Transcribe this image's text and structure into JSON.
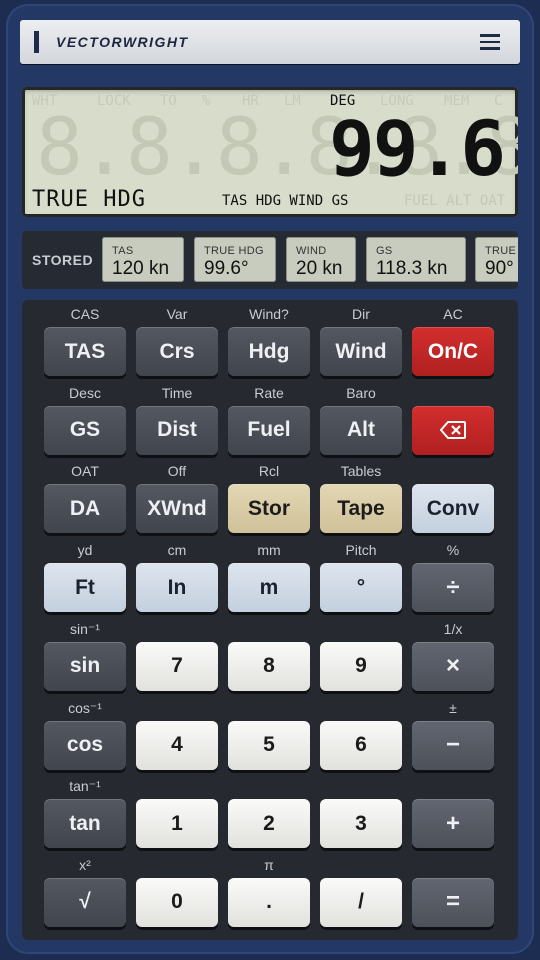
{
  "header": {
    "brand": "VECTORWRIGHT",
    "menu_icon": "hamburger-menu-icon"
  },
  "display": {
    "annunciators": [
      {
        "label": "WHT",
        "on": false
      },
      {
        "label": "LOCK",
        "on": false
      },
      {
        "label": "TO",
        "on": false
      },
      {
        "label": "%",
        "on": false
      },
      {
        "label": "HR",
        "on": false
      },
      {
        "label": "LM",
        "on": false
      },
      {
        "label": "DEG",
        "on": true
      },
      {
        "label": "LONG",
        "on": false
      },
      {
        "label": "MEM",
        "on": false
      },
      {
        "label": "C",
        "on": false
      }
    ],
    "ghost_digits": "8.8.8.8.8.8.8.8.8",
    "value": "99.6",
    "label": "TRUE HDG",
    "key_row": "TAS HDG WIND GS",
    "key_row_ghost": "FUEL ALT OAT"
  },
  "stored": {
    "label": "STORED",
    "items": [
      {
        "title": "TAS",
        "value": "120 kn"
      },
      {
        "title": "TRUE HDG",
        "value": "99.6°"
      },
      {
        "title": "WIND",
        "value": "20 kn"
      },
      {
        "title": "GS",
        "value": "118.3 kn"
      },
      {
        "title": "TRUE",
        "value": "90°"
      }
    ]
  },
  "keypad": {
    "rows": [
      [
        {
          "sub": "CAS",
          "label": "TAS",
          "style": "dark"
        },
        {
          "sub": "Var",
          "label": "Crs",
          "style": "dark"
        },
        {
          "sub": "Wind?",
          "label": "Hdg",
          "style": "dark"
        },
        {
          "sub": "Dir",
          "label": "Wind",
          "style": "dark"
        },
        {
          "sub": "AC",
          "label": "On/C",
          "style": "red"
        }
      ],
      [
        {
          "sub": "Desc",
          "label": "GS",
          "style": "dark"
        },
        {
          "sub": "Time",
          "label": "Dist",
          "style": "dark"
        },
        {
          "sub": "Rate",
          "label": "Fuel",
          "style": "dark"
        },
        {
          "sub": "Baro",
          "label": "Alt",
          "style": "dark"
        },
        {
          "sub": "",
          "label": "",
          "style": "red",
          "icon": "backspace-icon"
        }
      ],
      [
        {
          "sub": "OAT",
          "label": "DA",
          "style": "dark"
        },
        {
          "sub": "Off",
          "label": "XWnd",
          "style": "dark"
        },
        {
          "sub": "Rcl",
          "label": "Stor",
          "style": "tan"
        },
        {
          "sub": "Tables",
          "label": "Tape",
          "style": "tan"
        },
        {
          "sub": "",
          "label": "Conv",
          "style": "blue"
        }
      ],
      [
        {
          "sub": "yd",
          "label": "Ft",
          "style": "blue"
        },
        {
          "sub": "cm",
          "label": "In",
          "style": "blue"
        },
        {
          "sub": "mm",
          "label": "m",
          "style": "blue"
        },
        {
          "sub": "Pitch",
          "label": "°",
          "style": "blue"
        },
        {
          "sub": "%",
          "label": "÷",
          "style": "gray"
        }
      ],
      [
        {
          "sub": "sin⁻¹",
          "label": "sin",
          "style": "dark"
        },
        {
          "sub": "",
          "label": "7",
          "style": "white"
        },
        {
          "sub": "",
          "label": "8",
          "style": "white"
        },
        {
          "sub": "",
          "label": "9",
          "style": "white"
        },
        {
          "sub": "1/x",
          "label": "×",
          "style": "gray"
        }
      ],
      [
        {
          "sub": "cos⁻¹",
          "label": "cos",
          "style": "dark"
        },
        {
          "sub": "",
          "label": "4",
          "style": "white"
        },
        {
          "sub": "",
          "label": "5",
          "style": "white"
        },
        {
          "sub": "",
          "label": "6",
          "style": "white"
        },
        {
          "sub": "±",
          "label": "−",
          "style": "gray"
        }
      ],
      [
        {
          "sub": "tan⁻¹",
          "label": "tan",
          "style": "dark"
        },
        {
          "sub": "",
          "label": "1",
          "style": "white"
        },
        {
          "sub": "",
          "label": "2",
          "style": "white"
        },
        {
          "sub": "",
          "label": "3",
          "style": "white"
        },
        {
          "sub": "",
          "label": "+",
          "style": "gray"
        }
      ],
      [
        {
          "sub": "x²",
          "label": "√",
          "style": "dark"
        },
        {
          "sub": "",
          "label": "0",
          "style": "white"
        },
        {
          "sub": "π",
          "label": ".",
          "style": "white"
        },
        {
          "sub": "",
          "label": "/",
          "style": "white"
        },
        {
          "sub": "",
          "label": "=",
          "style": "gray"
        }
      ]
    ]
  }
}
